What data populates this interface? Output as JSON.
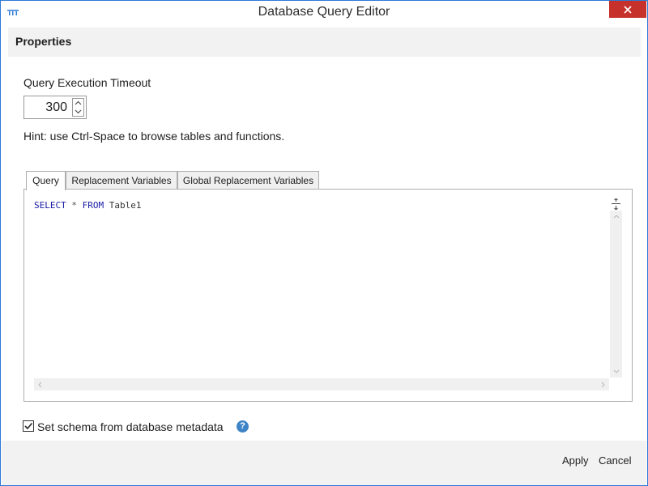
{
  "window": {
    "title": "Database Query Editor",
    "accent_color": "#2b79d6",
    "close_color": "#c7312b"
  },
  "properties": {
    "header": "Properties"
  },
  "timeout": {
    "label": "Query Execution Timeout",
    "value": "300"
  },
  "hint": "Hint: use Ctrl-Space to browse tables and functions.",
  "tabs": [
    {
      "label": "Query",
      "active": true
    },
    {
      "label": "Replacement Variables",
      "active": false
    },
    {
      "label": "Global Replacement Variables",
      "active": false
    }
  ],
  "editor": {
    "tokens": [
      {
        "text": "SELECT",
        "kind": "keyword"
      },
      {
        "text": " * ",
        "kind": "operator"
      },
      {
        "text": "FROM",
        "kind": "keyword"
      },
      {
        "text": " Table1",
        "kind": "identifier"
      }
    ]
  },
  "schema_checkbox": {
    "label": "Set schema from database metadata",
    "checked": true
  },
  "footer": {
    "apply": "Apply",
    "cancel": "Cancel"
  }
}
